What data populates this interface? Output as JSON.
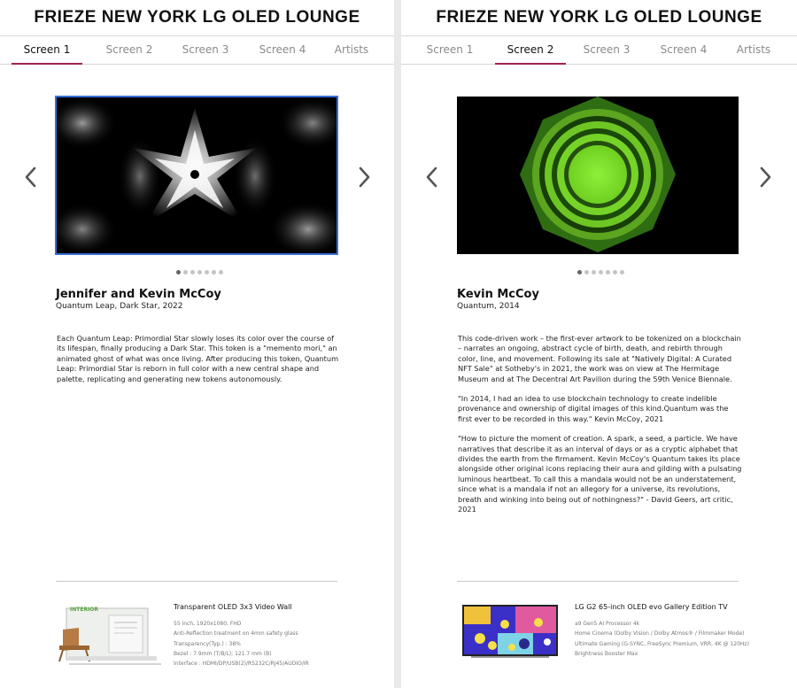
{
  "left": {
    "title": "FRIEZE NEW YORK LG OLED LOUNGE",
    "tabs": [
      "Screen 1",
      "Screen 2",
      "Screen 3",
      "Screen 4",
      "Artists"
    ],
    "active_tab": "Screen 1",
    "carousel": {
      "dot_count": 7,
      "active_index": 0
    },
    "artist": "Jennifer and Kevin McCoy",
    "work": "Quantum Leap, Dark Star, 2022",
    "description": [
      "Each Quantum Leap: Primordial Star slowly loses its color over the course of its lifespan, finally producing a Dark Star. This token is a \"memento mori,\" an animated ghost of what was once living. After producing this token, Quantum Leap: Primordial Star is reborn in full color with a new central shape and palette, replicating and generating new tokens autonomously."
    ],
    "product": {
      "name": "Transparent OLED 3x3 Video Wall",
      "specs": [
        "55 inch, 1920x1080, FHD",
        "Anti-Reflection treatment on 4mm safety glass",
        "Transparency(Typ.) : 38%",
        "Bezel : 7.9mm (T/B/L); 121.7 mm (B)",
        "Interface : HDMI/DP/USB(2)/RS232C/RJ45/AUDIO/IR"
      ],
      "thumb_label": "INTERIOR"
    }
  },
  "right": {
    "title": "FRIEZE NEW YORK LG OLED LOUNGE",
    "tabs": [
      "Screen 1",
      "Screen 2",
      "Screen 3",
      "Screen 4",
      "Artists"
    ],
    "active_tab": "Screen 2",
    "carousel": {
      "dot_count": 7,
      "active_index": 0
    },
    "artist": "Kevin McCoy",
    "work": "Quantum, 2014",
    "description": [
      "This code-driven work – the first-ever artwork to be tokenized on a blockchain – narrates an ongoing, abstract cycle of birth, death, and rebirth through color, line, and movement. Following its sale at \"Natively Digital: A Curated NFT Sale\" at Sotheby's in 2021, the work was on view at The Hermitage Museum and at The Decentral Art Pavilion during the 59th Venice Biennale.",
      "\"In 2014, I had an idea to use blockchain technology to create indelible provenance and ownership of digital images of this kind.Quantum was the first ever to be recorded in this way.\" Kevin McCoy, 2021",
      "\"How to picture the moment of creation. A spark, a seed, a particle. We have narratives that describe it as an interval of days or as a cryptic alphabet that divides the earth from the firmament. Kevin McCoy's Quantum takes its place alongside other original icons replacing their aura and gilding with a pulsating luminous heartbeat. To call this a mandala would not be an understatement, since what is a mandala if not an allegory for a universe, its revolutions, breath and winking into being out of nothingness?\" - David Geers, art critic, 2021"
    ],
    "product": {
      "name": "LG G2 65-inch OLED evo Gallery Edition TV",
      "specs": [
        "a9 Gen5 AI Processor 4k",
        "Home Cinema (Dolby Vision / Dolby Atmos® / Filmmaker Mode)",
        "Ultimate Gaming (G-SYNC, FreeSync Premium, VRR, 4K @ 120Hz)",
        "Brightness Booster Max"
      ]
    }
  },
  "colors": {
    "accent": "#a0234c",
    "selection": "#3a6fd8",
    "mandala_green": "#7ee02a"
  },
  "icons": [
    "chevron-left-icon",
    "chevron-right-icon"
  ]
}
